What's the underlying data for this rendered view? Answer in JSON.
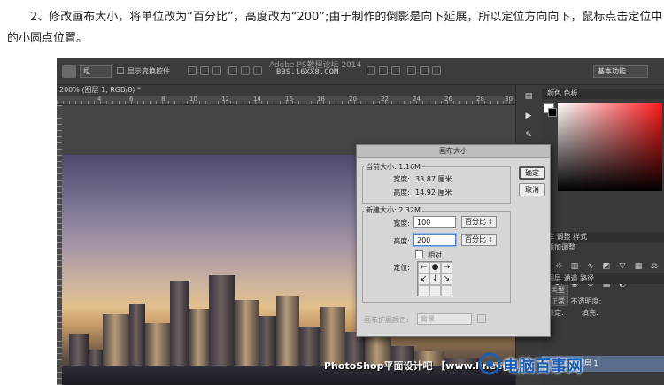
{
  "instruction": {
    "line1": "2、修改画布大小，将单位改为“百分比”，高度改为“200”;由于制作的倒影是向下延展，所以定位方向向下，鼠标点击定位中",
    "line2": "的小圆点位置。"
  },
  "photoshop": {
    "options_bar": {
      "preset": "组",
      "show_transform_label": "显示变换控件",
      "app_title": "Adobe PS教程论坛 2014",
      "watermark": "BBS.16XX8.COM",
      "workspace": "基本功能"
    },
    "document_tab": "200% (图层 1, RGB/8) *",
    "ruler_ticks": [
      "4",
      "6",
      "8",
      "10",
      "12",
      "14",
      "16",
      "18",
      "20",
      "22",
      "24",
      "26",
      "28",
      "30"
    ],
    "photo_credit": "PhotoShop平面设计吧 【www.lineeg.com/tieba/1783】",
    "panels": {
      "color_tabs": "颜色  色板",
      "adjust_tabs": "库  调整  样式",
      "adjust_label": "添加调整",
      "layers_tabs": "图层  通道  路径",
      "kind_label": "类型",
      "blend_mode": "正常",
      "opacity_label": "不透明度:",
      "lock_label": "锁定:",
      "fill_label": "填充:",
      "layer_name": "图层 1"
    },
    "canvas_size_dialog": {
      "title": "画布大小",
      "current_size_label": "当前大小: 1.16M",
      "width_label": "宽度:",
      "width_value": "33.87 厘米",
      "height_label": "高度:",
      "height_value": "14.92 厘米",
      "new_size_label": "新建大小: 2.32M",
      "new_width_value": "100",
      "new_height_value": "200",
      "unit": "百分比",
      "relative_label": "相对",
      "anchor_label": "定位:",
      "extension_color_label": "画布扩展颜色:",
      "extension_color_value": "背景",
      "ok_label": "确定",
      "cancel_label": "取消",
      "anchor_arrows": [
        "←",
        "●",
        "→",
        "↙",
        "↓",
        "↘",
        "",
        "",
        ""
      ]
    }
  },
  "brand_watermark": "电脑百事网",
  "colors": {
    "ps_dark": "#535353",
    "dialog_bg": "#d6d6d6",
    "brand_blue": "#1a5fb4",
    "focus_blue": "#4a86d0"
  }
}
